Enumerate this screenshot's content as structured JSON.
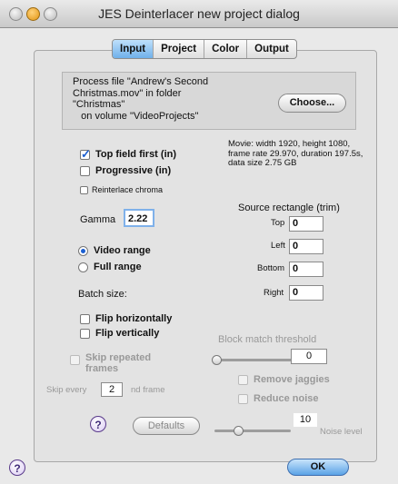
{
  "window": {
    "title": "JES Deinterlacer new project dialog"
  },
  "tabs": [
    {
      "label": "Input",
      "active": true
    },
    {
      "label": "Project",
      "active": false
    },
    {
      "label": "Color",
      "active": false
    },
    {
      "label": "Output",
      "active": false
    }
  ],
  "file": {
    "text": "Process file \"Andrew's Second\nChristmas.mov\" in folder\n\"Christmas\"\n   on volume \"VideoProjects\"",
    "choose_label": "Choose..."
  },
  "options": {
    "top_field_first": {
      "label": "Top field first (in)",
      "checked": true
    },
    "progressive": {
      "label": "Progressive (in)",
      "checked": false
    },
    "reinterlace_chroma": {
      "label": "Reinterlace chroma",
      "checked": false
    }
  },
  "movie_info": "Movie: width 1920, height 1080, frame rate 29.970, duration 197.5s, data size 2.75 GB",
  "gamma": {
    "label": "Gamma",
    "value": "2.22"
  },
  "range": {
    "video": {
      "label": "Video range",
      "selected": true
    },
    "full": {
      "label": "Full range",
      "selected": false
    }
  },
  "source_rect": {
    "title": "Source rectangle (trim)",
    "top": {
      "label": "Top",
      "value": "0"
    },
    "left": {
      "label": "Left",
      "value": "0"
    },
    "bottom": {
      "label": "Bottom",
      "value": "0"
    },
    "right": {
      "label": "Right",
      "value": "0"
    }
  },
  "batch_size": {
    "label": "Batch size:"
  },
  "flip": {
    "horizontal": {
      "label": "Flip horizontally",
      "checked": false
    },
    "vertical": {
      "label": "Flip vertically",
      "checked": false
    }
  },
  "block_match": {
    "label": "Block match threshold",
    "value": "0",
    "level": 0.0
  },
  "skip_repeated": {
    "label": "Skip repeated\nframes",
    "checked": false
  },
  "skip_every": {
    "prefix": "Skip every",
    "value": "2",
    "suffix": "nd frame"
  },
  "remove_jaggies": {
    "label": "Remove jaggies",
    "checked": false
  },
  "reduce_noise": {
    "label": "Reduce noise",
    "checked": false
  },
  "noise": {
    "value": "10",
    "label": "Noise level",
    "level": 0.3
  },
  "buttons": {
    "help": "?",
    "defaults": "Defaults",
    "ok": "OK"
  },
  "icons": {
    "help": "help-icon"
  }
}
